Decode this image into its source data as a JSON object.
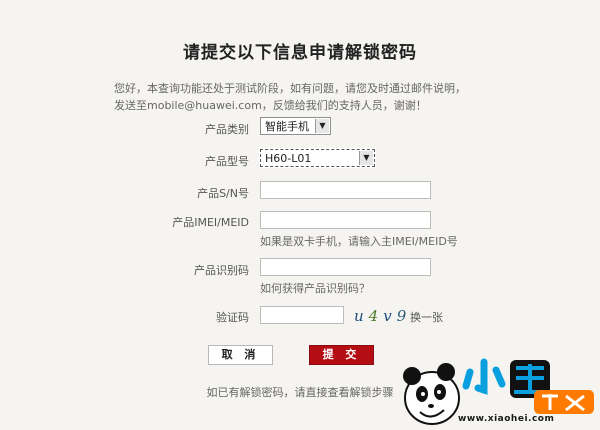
{
  "page": {
    "title": "请提交以下信息申请解锁密码",
    "intro": "您好，本查询功能还处于测试阶段，如有问题，请您及时通过邮件说明，发送至mobile@huawei.com，反馈给我们的支持人员，谢谢！"
  },
  "form": {
    "category": {
      "label": "产品类别",
      "value": "智能手机"
    },
    "model": {
      "label": "产品型号",
      "value": "H60-L01"
    },
    "sn": {
      "label": "产品S/N号",
      "value": ""
    },
    "imei": {
      "label": "产品IMEI/MEID",
      "value": "",
      "hint": "如果是双卡手机，请输入主IMEI/MEID号"
    },
    "product_id": {
      "label": "产品识别码",
      "value": "",
      "hint": "如何获得产品识别码？"
    },
    "captcha": {
      "label": "验证码",
      "value": "",
      "code": [
        "u",
        "4",
        "v",
        "9"
      ],
      "refresh": "换一张"
    }
  },
  "buttons": {
    "cancel": "取 消",
    "submit": "提 交"
  },
  "footer": {
    "text": "如已有解锁密码，请直接查看解锁步骤"
  },
  "watermark": {
    "url": "www.xiaohei.com"
  },
  "colors": {
    "submit": "#b40e14",
    "background": "#f5f4f1"
  }
}
